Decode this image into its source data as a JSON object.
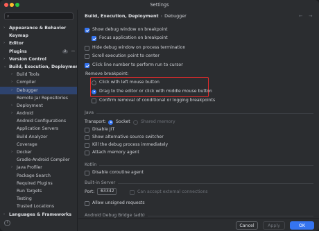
{
  "window": {
    "title": "Settings"
  },
  "search": {
    "placeholder": "",
    "icon": "search-icon"
  },
  "sidebar": {
    "items": [
      {
        "label": "Appearance & Behavior",
        "level": 0,
        "arrow": "›",
        "bold": true
      },
      {
        "label": "Keymap",
        "level": 0,
        "arrow": "",
        "bold": true
      },
      {
        "label": "Editor",
        "level": 0,
        "arrow": "›",
        "bold": true
      },
      {
        "label": "Plugins",
        "level": 0,
        "arrow": "",
        "bold": true,
        "badge": "2"
      },
      {
        "label": "Version Control",
        "level": 0,
        "arrow": "›",
        "bold": true
      },
      {
        "label": "Build, Execution, Deployment",
        "level": 0,
        "arrow": "⌄",
        "bold": true
      },
      {
        "label": "Build Tools",
        "level": 1,
        "arrow": "›"
      },
      {
        "label": "Compiler",
        "level": 1,
        "arrow": "›"
      },
      {
        "label": "Debugger",
        "level": 1,
        "arrow": "›",
        "selected": true
      },
      {
        "label": "Remote Jar Repositories",
        "level": 1,
        "arrow": ""
      },
      {
        "label": "Deployment",
        "level": 1,
        "arrow": "›"
      },
      {
        "label": "Android",
        "level": 1,
        "arrow": "›"
      },
      {
        "label": "Android Configurations",
        "level": 1,
        "arrow": ""
      },
      {
        "label": "Application Servers",
        "level": 1,
        "arrow": ""
      },
      {
        "label": "Build Analyzer",
        "level": 1,
        "arrow": ""
      },
      {
        "label": "Coverage",
        "level": 1,
        "arrow": ""
      },
      {
        "label": "Docker",
        "level": 1,
        "arrow": "›"
      },
      {
        "label": "Gradle-Android Compiler",
        "level": 1,
        "arrow": ""
      },
      {
        "label": "Java Profiler",
        "level": 1,
        "arrow": "›"
      },
      {
        "label": "Package Search",
        "level": 1,
        "arrow": ""
      },
      {
        "label": "Required Plugins",
        "level": 1,
        "arrow": ""
      },
      {
        "label": "Run Targets",
        "level": 1,
        "arrow": ""
      },
      {
        "label": "Testing",
        "level": 1,
        "arrow": ""
      },
      {
        "label": "Trusted Locations",
        "level": 1,
        "arrow": ""
      },
      {
        "label": "Languages & Frameworks",
        "level": 0,
        "arrow": "›",
        "bold": true
      }
    ]
  },
  "breadcrumb": {
    "parent": "Build, Execution, Deployment",
    "separator": "›",
    "page": "Debugger"
  },
  "options": {
    "show_debug_window": "Show debug window on breakpoint",
    "focus_application": "Focus application on breakpoint",
    "hide_debug_window": "Hide debug window on process termination",
    "scroll_execution_point": "Scroll execution point to center",
    "click_line_number": "Click line number to perform run to cursor",
    "remove_breakpoint_label": "Remove breakpoint:",
    "click_left_mouse": "Click with left mouse button",
    "drag_to_editor": "Drag to the editor or click with middle mouse button",
    "confirm_removal": "Confirm removal of conditional or logging breakpoints"
  },
  "java": {
    "section": "Java",
    "transport_label": "Transport:",
    "socket": "Socket",
    "shared_memory": "Shared memory",
    "disable_jit": "Disable JIT",
    "show_alt_source": "Show alternative source switcher",
    "kill_debug_process": "Kill the debug process immediately",
    "attach_memory_agent": "Attach memory agent"
  },
  "kotlin": {
    "section": "Kotlin",
    "disable_coroutine": "Disable coroutine agent"
  },
  "server": {
    "section": "Built-in Server",
    "port_label": "Port:",
    "port_value": "63342",
    "can_accept": "Can accept external connections",
    "allow_unsigned": "Allow unsigned requests"
  },
  "android_section": "Android Debug Bridge (adb)",
  "footer": {
    "cancel": "Cancel",
    "apply": "Apply",
    "ok": "OK",
    "help": "?"
  },
  "colors": {
    "accent": "#3574f0",
    "highlight_box": "#e52b2b",
    "selected_row": "#2e436e"
  }
}
